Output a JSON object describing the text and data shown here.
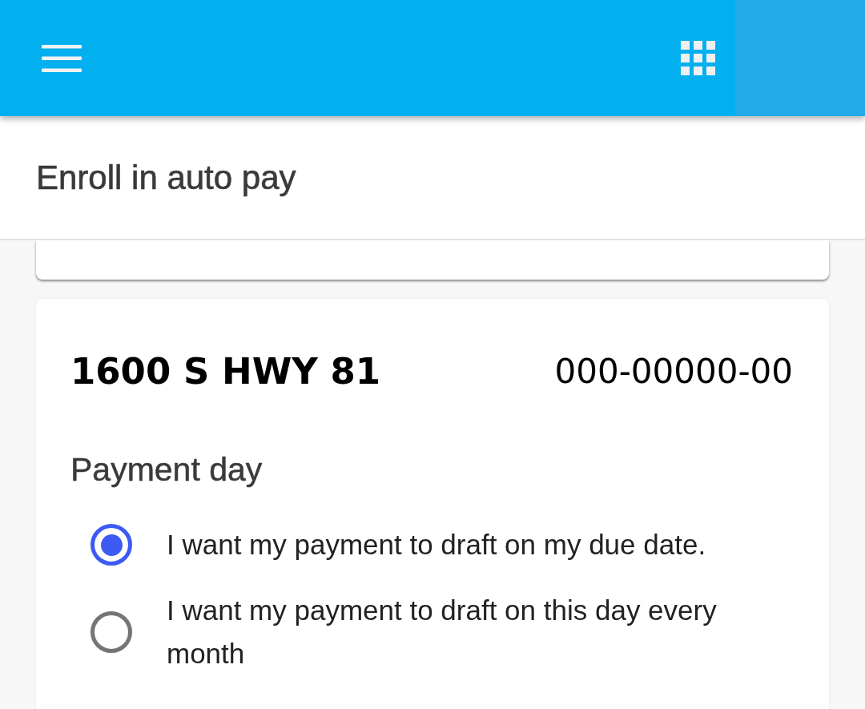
{
  "page_title": "Enroll in auto pay",
  "account_card": {
    "address": "1600 S HWY 81",
    "account_number": "000-00000-00",
    "section_title": "Payment day",
    "options": [
      {
        "label": "I want my payment to draft on my due date.",
        "selected": true
      },
      {
        "label": "I want my payment to draft on this day every month",
        "selected": false
      }
    ]
  }
}
